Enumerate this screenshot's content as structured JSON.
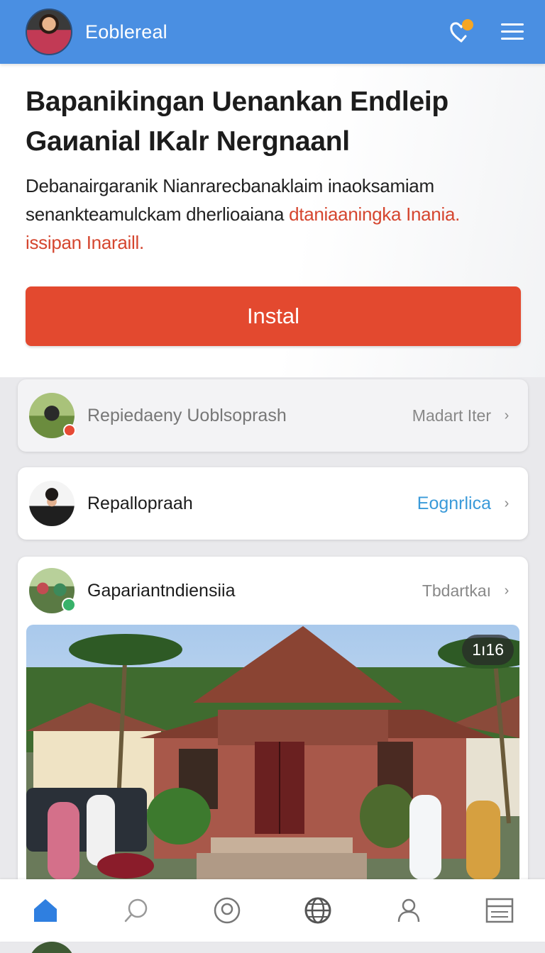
{
  "header": {
    "app_title": "Eoblereal",
    "icons": [
      "profile-avatar",
      "heart-badge-icon",
      "menu-icon"
    ],
    "notification_color": "#f5a623"
  },
  "promo": {
    "title_line1": "Bapanikingan Uenankan Endleip",
    "title_line2": "Gaиanial IKalr Nergnaanl",
    "desc_plain": "Debanairgaranik Nianrarecbanaklaim inaoksamiam senankteamulckam dherlioaiana ",
    "desc_accent": "dtaniaaningka Inania. issipan Inaraill.",
    "install_label": "Instal",
    "accent_color": "#e3492f"
  },
  "feed": [
    {
      "name": "Repiedaeny Uoblsoprash",
      "meta": "Madart Iter",
      "status": "red-dot"
    },
    {
      "name": "Repallopraah",
      "meta": "Eognrlica"
    },
    {
      "name": "Gapariantndiensiia",
      "meta": "Tbdartkaı",
      "status": "green-dot",
      "photo_count": "1ı16"
    }
  ],
  "bottom_nav": {
    "items": [
      "home-icon",
      "search-icon",
      "profile-circle-icon",
      "globe-icon",
      "person-icon",
      "list-icon"
    ],
    "active_index": 0,
    "active_color": "#2f7fe0"
  }
}
